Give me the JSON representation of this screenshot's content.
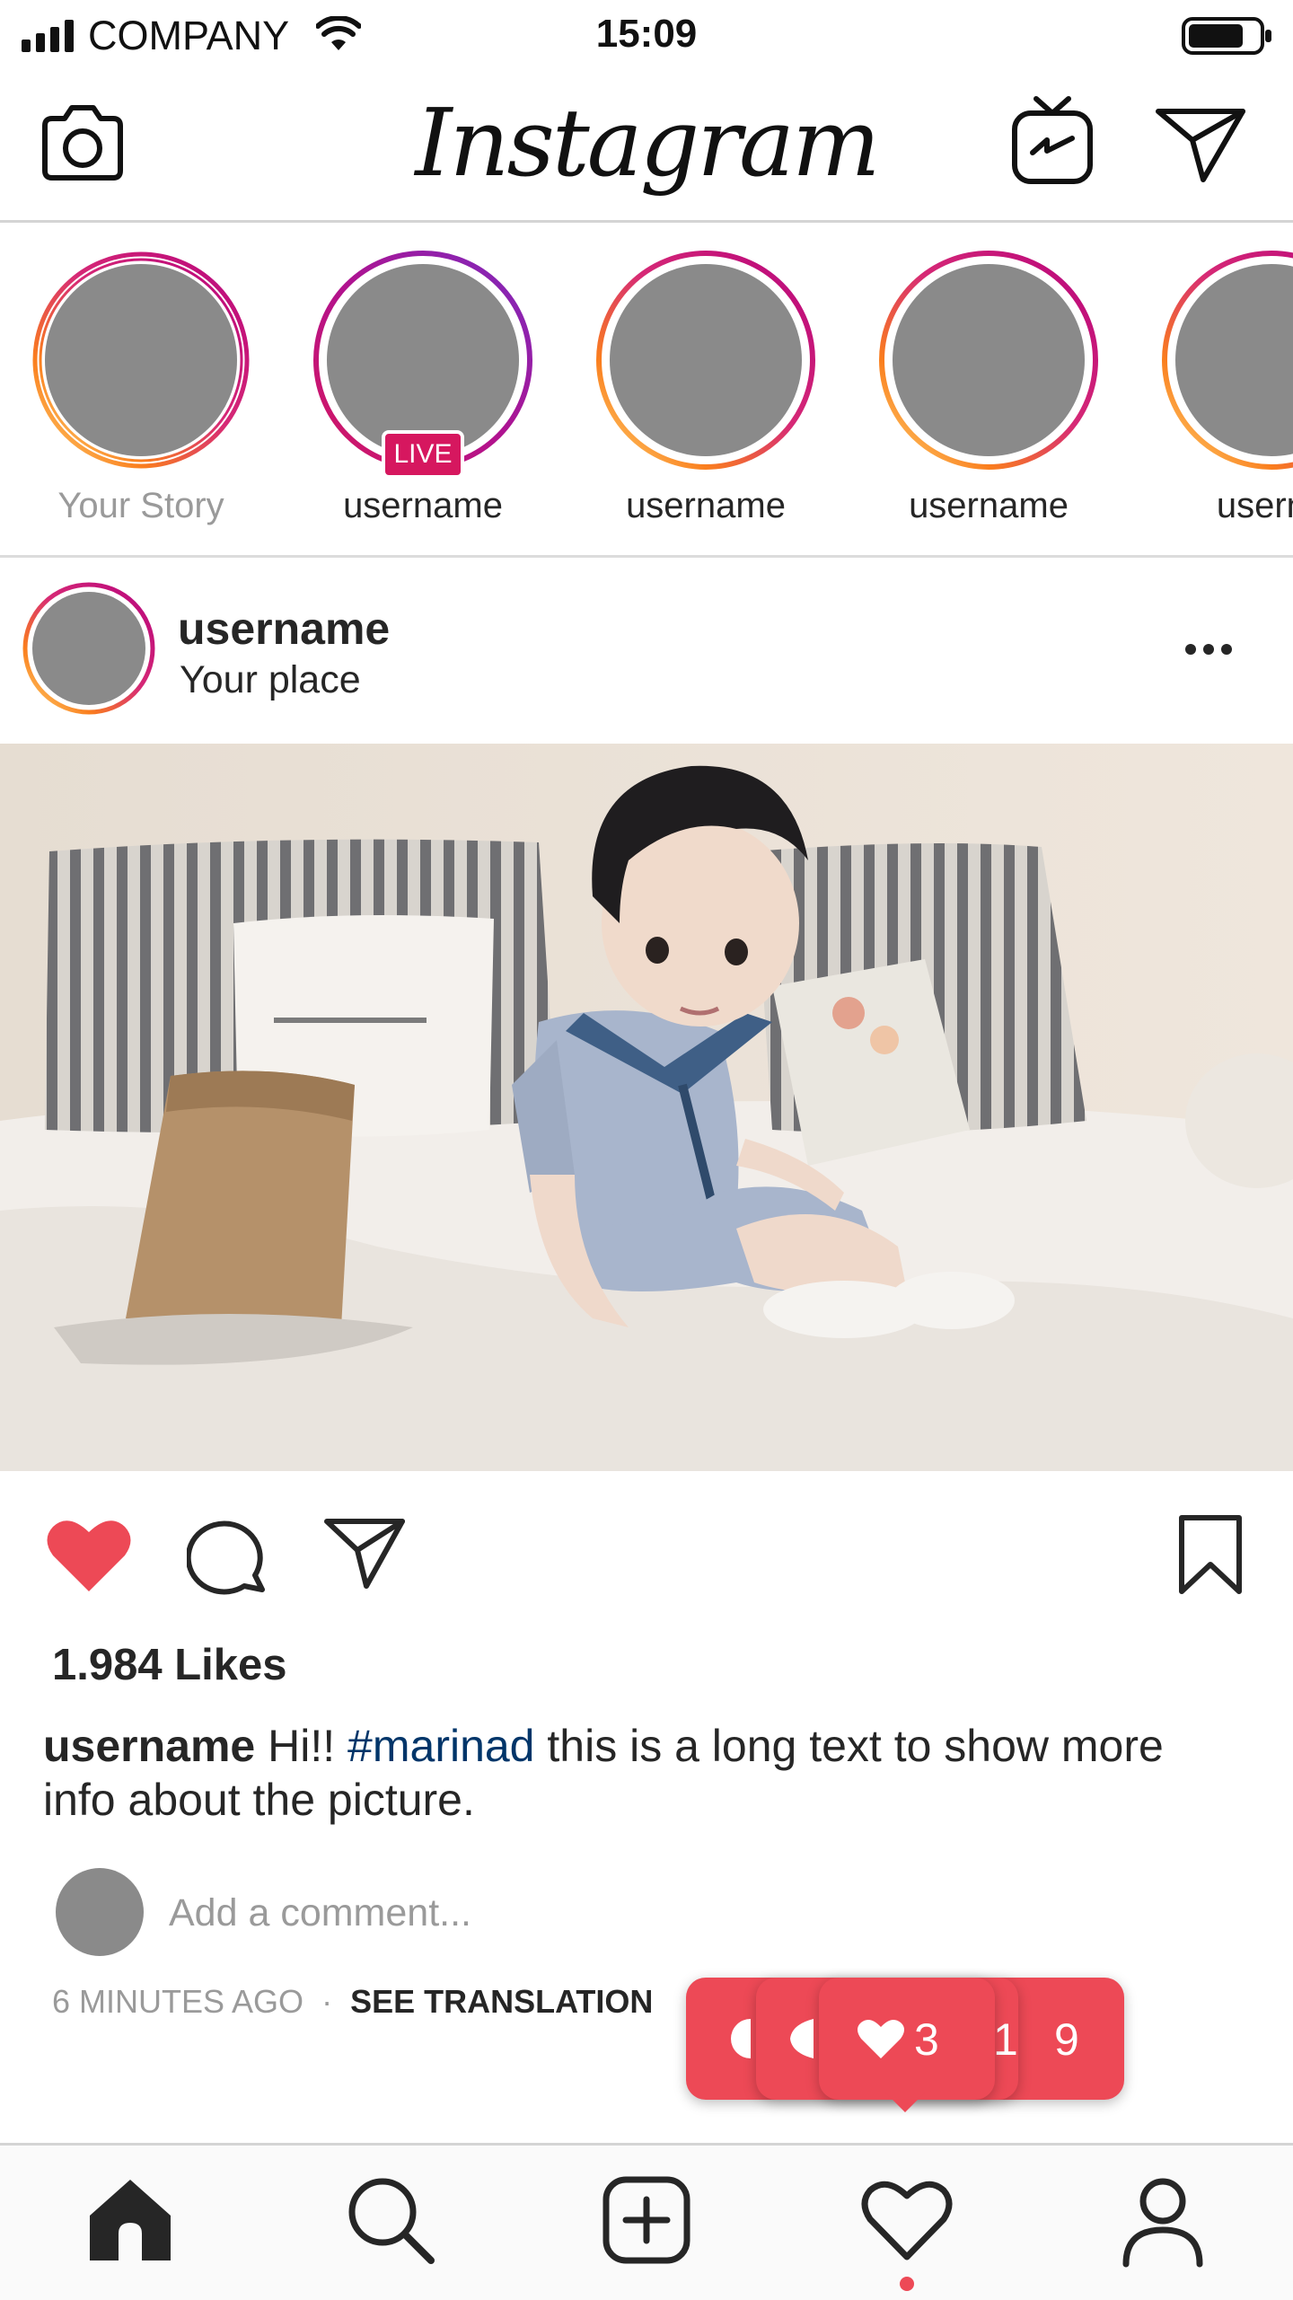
{
  "status_bar": {
    "carrier": "COMPANY",
    "time": "15:09",
    "signal_icon": "signal-bars-icon",
    "wifi_icon": "wifi-icon",
    "battery_icon": "battery-icon"
  },
  "navbar": {
    "logo_text": "Instagram",
    "camera_icon": "camera-icon",
    "igtv_icon": "igtv-icon",
    "direct_icon": "paper-plane-icon"
  },
  "stories": {
    "items": [
      {
        "label": "Your Story",
        "live": false
      },
      {
        "label": "username",
        "live": true,
        "live_label": "LIVE"
      },
      {
        "label": "username",
        "live": false
      },
      {
        "label": "username",
        "live": false
      },
      {
        "label": "userna",
        "live": false
      }
    ]
  },
  "post": {
    "username": "username",
    "location": "Your place",
    "more_icon": "more-dots-icon",
    "photo_subject": "photo",
    "liked": true,
    "likes": "1.984 Likes",
    "caption": {
      "user": "username",
      "text_before": "Hi!! ",
      "hashtag": "#marinad",
      "text_after": " this is a long text to show more info about the picture."
    },
    "comment_placeholder": "Add a comment...",
    "time": "6 MINUTES AGO",
    "separator": "·",
    "see_translation": "SEE TRANSLATION"
  },
  "activity_toast": {
    "likes_count": "3",
    "comments_count": "1",
    "follows_count": "9",
    "heart_icon": "heart-icon",
    "comment_icon": "comment-bubble-icon",
    "follow_icon": "person-icon"
  },
  "tabbar": {
    "tabs": [
      {
        "name": "home",
        "icon": "home-icon",
        "active": true
      },
      {
        "name": "search",
        "icon": "search-icon",
        "active": false
      },
      {
        "name": "new-post",
        "icon": "plus-square-icon",
        "active": false
      },
      {
        "name": "activity",
        "icon": "heart-outline-icon",
        "active": false,
        "notification_dot": true
      },
      {
        "name": "profile",
        "icon": "person-icon",
        "active": false
      }
    ]
  },
  "colors": {
    "like_red": "#ed4956",
    "live_badge": "#d6175f",
    "hashtag": "#003569",
    "muted_text": "#9a9a9a",
    "avatar_placeholder": "#8a8a8a"
  }
}
